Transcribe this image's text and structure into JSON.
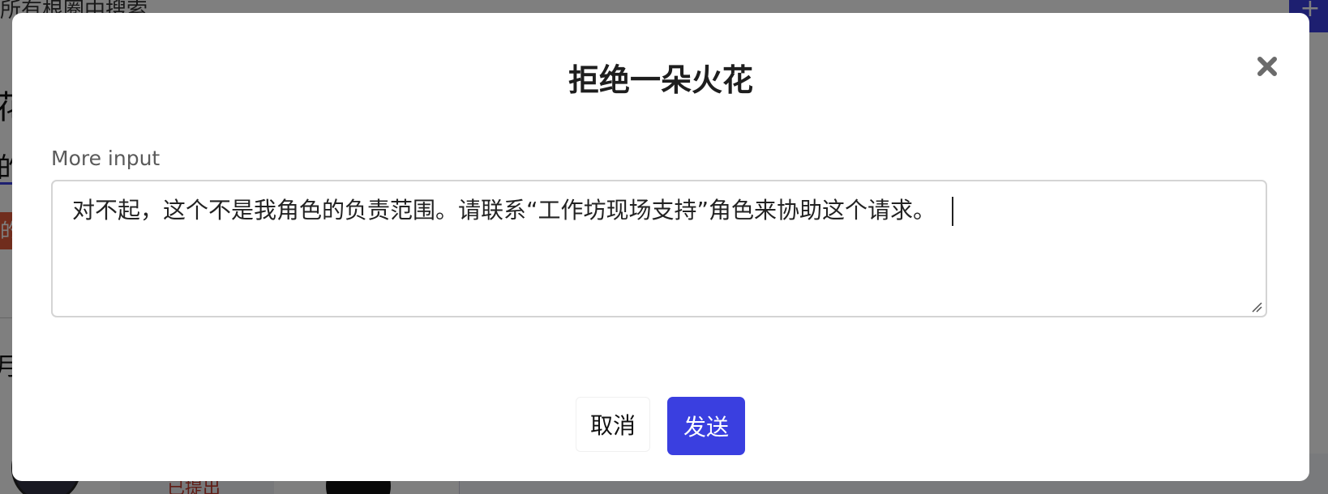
{
  "background": {
    "search_text": "所有根圈中搜索",
    "plus_label": "+",
    "char_1": "花",
    "char_2": "的",
    "red_tag": "的",
    "char_3": "月",
    "status_text": "已提出"
  },
  "modal": {
    "title": "拒绝一朵火花",
    "close_icon": "close-icon",
    "field_label": "More input",
    "textarea_value": "对不起，这个不是我角色的负责范围。请联系“工作坊现场支持”角色来协助这个请求。",
    "cancel_label": "取消",
    "send_label": "发送"
  },
  "colors": {
    "primary": "#3a3fe0",
    "overlay": "rgba(0,0,0,0.5)",
    "title_text": "#1e1e1e",
    "label_text": "#5a5a5a"
  }
}
